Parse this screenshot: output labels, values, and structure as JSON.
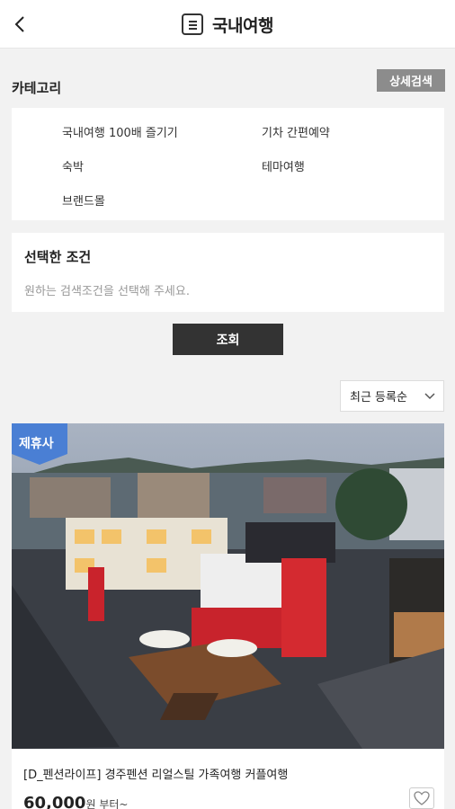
{
  "header": {
    "title": "국내여행",
    "back_icon": "chevron-left-icon",
    "menu_icon": "menu-icon"
  },
  "category": {
    "label": "카테고리",
    "detail_search_label": "상세검색",
    "items": [
      "국내여행 100배 즐기기",
      "기차 간편예약",
      "숙박",
      "테마여행",
      "브랜드몰"
    ]
  },
  "conditions": {
    "title": "선택한 조건",
    "hint": "원하는 검색조건을 선택해 주세요."
  },
  "search_button_label": "조회",
  "sort": {
    "selected": "최근 등록순"
  },
  "product": {
    "badge": "제휴사",
    "title": "[D_펜션라이프] 경주펜션 리얼스틸 가족여행 커플여행",
    "price": "60,000",
    "price_suffix": "원 부터~"
  },
  "colors": {
    "badge": "#4a7fd4",
    "dark_button": "#333333",
    "detail_button": "#8c8c8c"
  }
}
